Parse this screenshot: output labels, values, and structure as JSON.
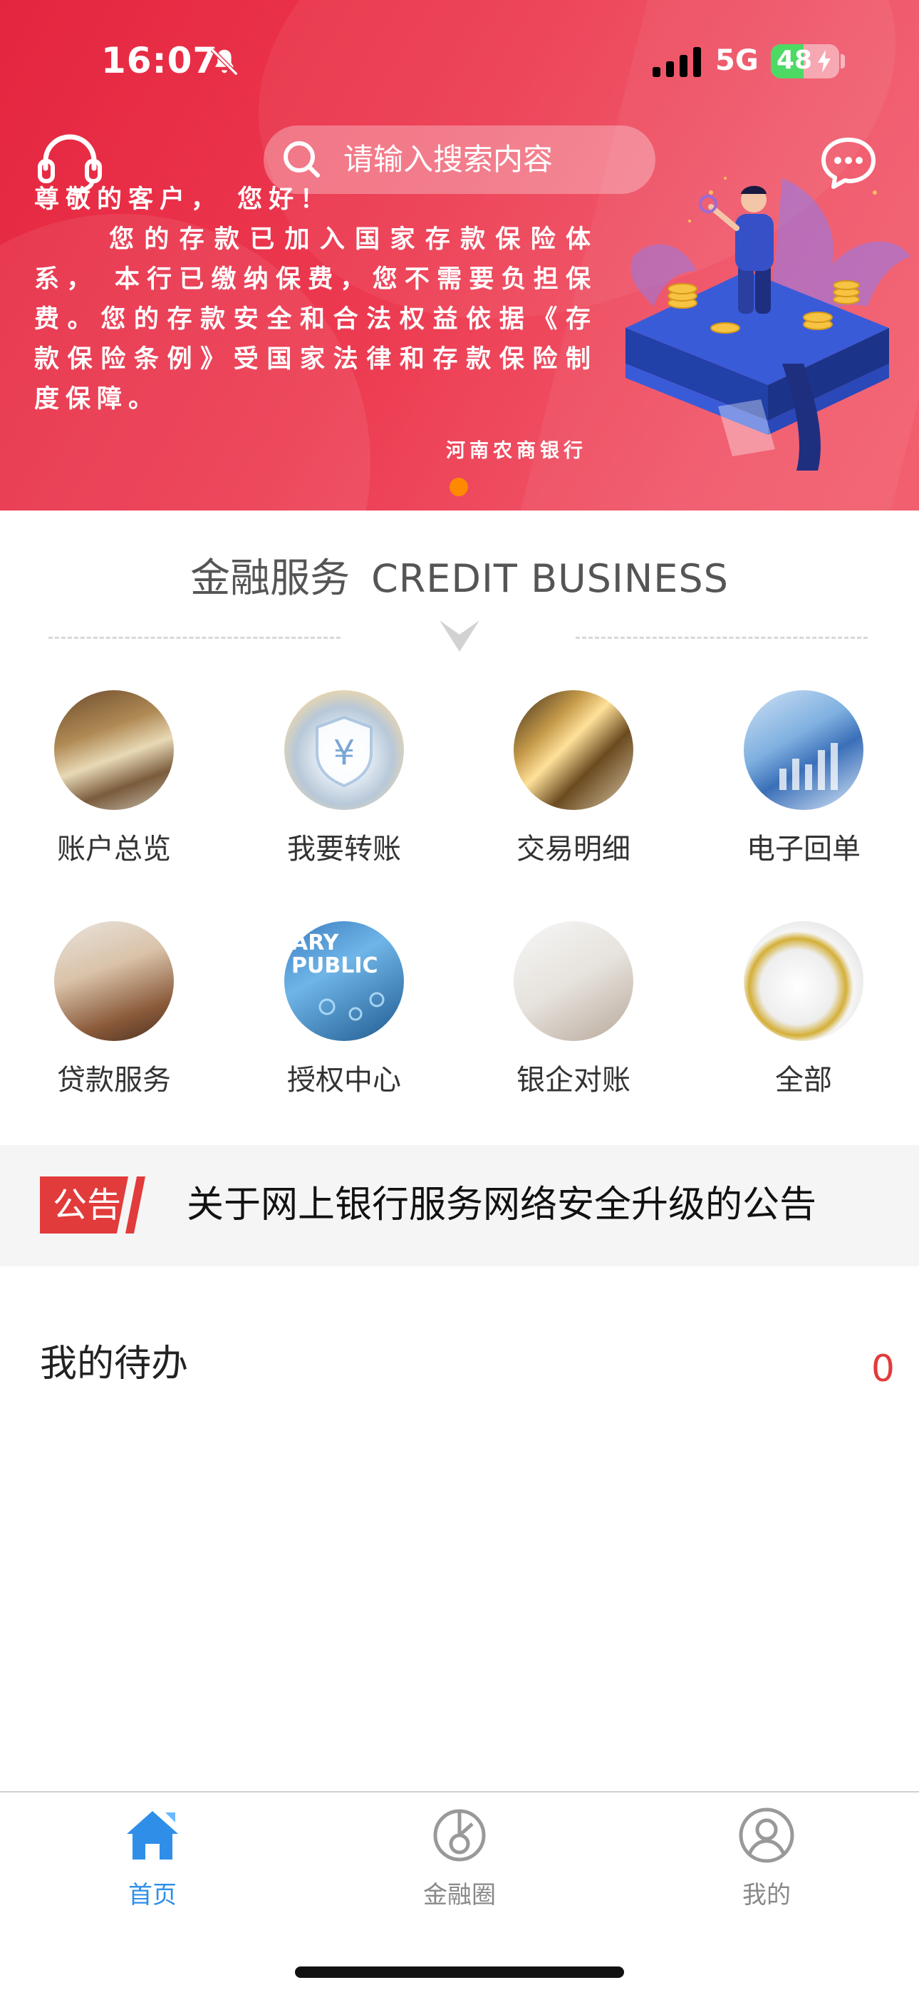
{
  "status_bar": {
    "time": "16:07",
    "network": "5G",
    "battery": "48",
    "battery_level": 0.48
  },
  "banner": {
    "search_placeholder": "请输入搜索内容",
    "notice_greeting": "尊敬的客户， 您好！",
    "notice_body": "您的存款已加入国家存款保险体系， 本行已缴纳保费，您不需要负担保费。您的存款安全和合法权益依据《存款保险条例》受国家法律和存款保险制度保障。",
    "notice_signature": "河南农商银行",
    "accent_color": "#e5253f"
  },
  "section": {
    "title_cn": "金融服务",
    "title_en": "CREDIT BUSINESS"
  },
  "services": [
    {
      "label": "账户总览"
    },
    {
      "label": "我要转账"
    },
    {
      "label": "交易明细"
    },
    {
      "label": "电子回单"
    },
    {
      "label": "贷款服务"
    },
    {
      "label": "授权中心"
    },
    {
      "label": "银企对账"
    },
    {
      "label": "全部"
    }
  ],
  "announcement": {
    "tag": "公告",
    "text": "关于网上银行服务网络安全升级的公告"
  },
  "todo": {
    "title": "我的待办",
    "count": "0"
  },
  "tabs": [
    {
      "label": "首页",
      "icon": "home-icon",
      "active": true
    },
    {
      "label": "金融圈",
      "icon": "finance-circle-icon",
      "active": false
    },
    {
      "label": "我的",
      "icon": "profile-icon",
      "active": false
    }
  ]
}
